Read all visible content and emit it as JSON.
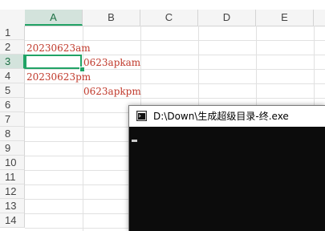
{
  "sheet": {
    "columns": [
      "A",
      "B",
      "C",
      "D",
      "E"
    ],
    "selected_column": "A",
    "rows": [
      "1",
      "2",
      "3",
      "4",
      "5",
      "6",
      "7",
      "8",
      "9",
      "10",
      "11",
      "12",
      "13",
      "14"
    ],
    "selected_row": "3",
    "cells": {
      "A2": "20230623am",
      "B3": "0623apkam",
      "A4": "20230623pm",
      "B5": "0623apkpm"
    },
    "colors": {
      "cell_text": "#c0392b",
      "accent": "#21a366"
    }
  },
  "console": {
    "title": "D:\\Down\\生成超级目录-终.exe",
    "icon": "console-app-icon",
    "background": "#0c0c0c"
  }
}
